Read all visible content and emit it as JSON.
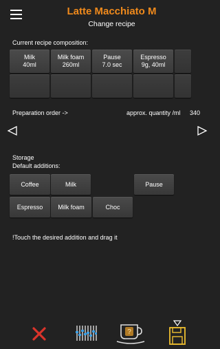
{
  "header": {
    "title": "Latte Macchiato M",
    "subtitle": "Change recipe"
  },
  "composition": {
    "label": "Current recipe composition:",
    "items": [
      {
        "name": "Milk",
        "value": "40ml"
      },
      {
        "name": "Milk foam",
        "value": "260ml"
      },
      {
        "name": "Pause",
        "value": "7.0 sec"
      },
      {
        "name": "Espresso",
        "value": "9g, 40ml"
      }
    ]
  },
  "preparation": {
    "label": "Preparation order ->",
    "quantity_label": "approx. quantity /ml",
    "quantity_value": "340"
  },
  "storage": {
    "label": "Storage",
    "default_label": "Default additions:",
    "buttons": {
      "coffee": "Coffee",
      "milk": "Milk",
      "pause": "Pause",
      "espresso": "Espresso",
      "milk_foam": "Milk foam",
      "choc": "Choc"
    }
  },
  "hint": "!Touch the desired addition and drag it",
  "footer": {
    "cancel_icon": "x-icon",
    "settings_icon": "sliders-icon",
    "help_icon": "cup-help-icon",
    "save_icon": "save-icon"
  },
  "colors": {
    "accent": "#f08a1c",
    "cancel": "#d9342b",
    "sliders": "#3aa0e6"
  }
}
